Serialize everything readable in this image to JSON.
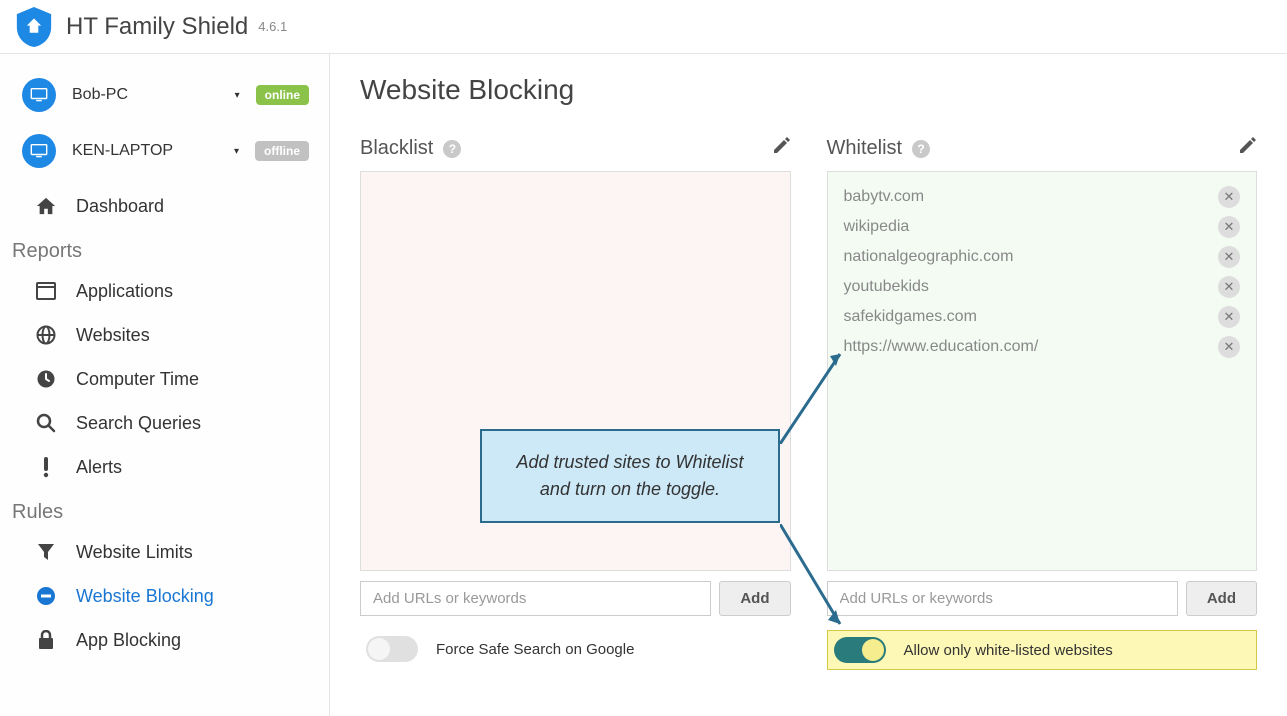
{
  "app": {
    "title": "HT Family Shield",
    "version": "4.6.1"
  },
  "devices": [
    {
      "name": "Bob-PC",
      "status": "online",
      "icon_bg": "#1e88e5"
    },
    {
      "name": "KEN-LAPTOP",
      "status": "offline",
      "icon_bg": "#1e88e5"
    }
  ],
  "nav": {
    "dashboard": "Dashboard",
    "reports_title": "Reports",
    "reports": [
      {
        "id": "applications",
        "label": "Applications"
      },
      {
        "id": "websites",
        "label": "Websites"
      },
      {
        "id": "computer-time",
        "label": "Computer Time"
      },
      {
        "id": "search-queries",
        "label": "Search Queries"
      },
      {
        "id": "alerts",
        "label": "Alerts"
      }
    ],
    "rules_title": "Rules",
    "rules": [
      {
        "id": "website-limits",
        "label": "Website Limits"
      },
      {
        "id": "website-blocking",
        "label": "Website Blocking",
        "active": true
      },
      {
        "id": "app-blocking",
        "label": "App Blocking"
      }
    ]
  },
  "page": {
    "title": "Website Blocking",
    "blacklist": {
      "title": "Blacklist",
      "items": [],
      "placeholder": "Add URLs or keywords",
      "add_label": "Add",
      "toggle_label": "Force Safe Search on Google",
      "toggle_on": false
    },
    "whitelist": {
      "title": "Whitelist",
      "items": [
        "babytv.com",
        "wikipedia",
        "nationalgeographic.com",
        "youtubekids",
        "safekidgames.com",
        "https://www.education.com/"
      ],
      "placeholder": "Add URLs or keywords",
      "add_label": "Add",
      "toggle_label": "Allow only white-listed websites",
      "toggle_on": true
    }
  },
  "callout": {
    "line1": "Add trusted sites to Whitelist",
    "line2": "and turn on the toggle."
  }
}
